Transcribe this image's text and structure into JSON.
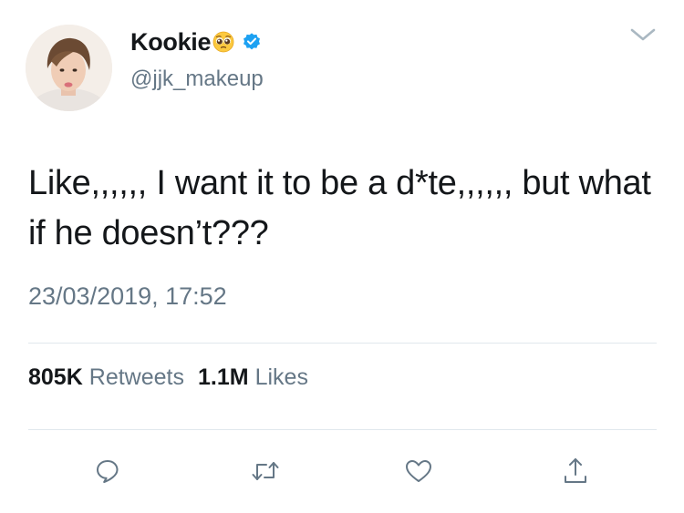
{
  "user": {
    "display_name": "Kookie",
    "name_emoji": "pleading-face-emoji",
    "verified": true,
    "handle": "@jjk_makeup"
  },
  "tweet": {
    "text": "Like,,,,,, I want it to be a d*te,,,,,, but what if he doesn’t???",
    "timestamp": "23/03/2019, 17:52"
  },
  "stats": {
    "retweets_count": "805K",
    "retweets_label": "Retweets",
    "likes_count": "1.1M",
    "likes_label": "Likes"
  },
  "actions": [
    "reply-icon",
    "retweet-icon",
    "like-icon",
    "share-icon"
  ],
  "colors": {
    "text_primary": "#14171a",
    "text_secondary": "#657786",
    "divider": "#e1e8ed",
    "verified_blue": "#1da1f2"
  }
}
